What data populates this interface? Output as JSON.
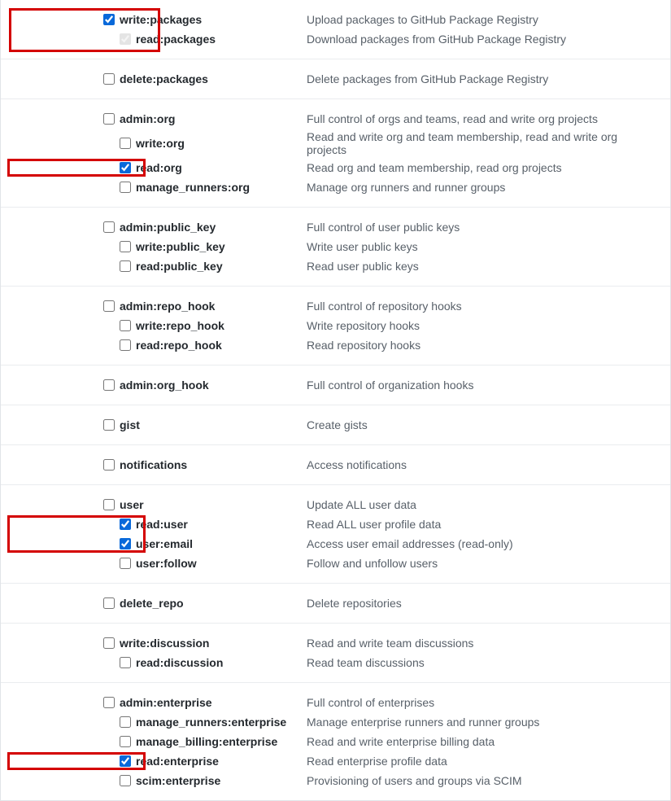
{
  "highlight_color": "#d40000",
  "sections": [
    {
      "highlight": true,
      "parent": {
        "label": "write:packages",
        "desc": "Upload packages to GitHub Package Registry",
        "checked": true,
        "disabled": false
      },
      "children": [
        {
          "label": "read:packages",
          "desc": "Download packages from GitHub Package Registry",
          "checked": true,
          "disabled": true
        }
      ]
    },
    {
      "parent": {
        "label": "delete:packages",
        "desc": "Delete packages from GitHub Package Registry",
        "checked": false
      },
      "children": []
    },
    {
      "parent": {
        "label": "admin:org",
        "desc": "Full control of orgs and teams, read and write org projects",
        "checked": false
      },
      "children": [
        {
          "label": "write:org",
          "desc": "Read and write org and team membership, read and write org projects",
          "checked": false
        },
        {
          "label": "read:org",
          "desc": "Read org and team membership, read org projects",
          "checked": true,
          "highlight": true
        },
        {
          "label": "manage_runners:org",
          "desc": "Manage org runners and runner groups",
          "checked": false
        }
      ]
    },
    {
      "parent": {
        "label": "admin:public_key",
        "desc": "Full control of user public keys",
        "checked": false
      },
      "children": [
        {
          "label": "write:public_key",
          "desc": "Write user public keys",
          "checked": false
        },
        {
          "label": "read:public_key",
          "desc": "Read user public keys",
          "checked": false
        }
      ]
    },
    {
      "parent": {
        "label": "admin:repo_hook",
        "desc": "Full control of repository hooks",
        "checked": false
      },
      "children": [
        {
          "label": "write:repo_hook",
          "desc": "Write repository hooks",
          "checked": false
        },
        {
          "label": "read:repo_hook",
          "desc": "Read repository hooks",
          "checked": false
        }
      ]
    },
    {
      "parent": {
        "label": "admin:org_hook",
        "desc": "Full control of organization hooks",
        "checked": false
      },
      "children": []
    },
    {
      "parent": {
        "label": "gist",
        "desc": "Create gists",
        "checked": false
      },
      "children": []
    },
    {
      "parent": {
        "label": "notifications",
        "desc": "Access notifications",
        "checked": false
      },
      "children": []
    },
    {
      "parent": {
        "label": "user",
        "desc": "Update ALL user data",
        "checked": false
      },
      "children": [
        {
          "label": "read:user",
          "desc": "Read ALL user profile data",
          "checked": true,
          "highlight_group": "user"
        },
        {
          "label": "user:email",
          "desc": "Access user email addresses (read-only)",
          "checked": true,
          "highlight_group": "user"
        },
        {
          "label": "user:follow",
          "desc": "Follow and unfollow users",
          "checked": false
        }
      ]
    },
    {
      "parent": {
        "label": "delete_repo",
        "desc": "Delete repositories",
        "checked": false
      },
      "children": []
    },
    {
      "parent": {
        "label": "write:discussion",
        "desc": "Read and write team discussions",
        "checked": false
      },
      "children": [
        {
          "label": "read:discussion",
          "desc": "Read team discussions",
          "checked": false
        }
      ]
    },
    {
      "parent": {
        "label": "admin:enterprise",
        "desc": "Full control of enterprises",
        "checked": false
      },
      "children": [
        {
          "label": "manage_runners:enterprise",
          "desc": "Manage enterprise runners and runner groups",
          "checked": false
        },
        {
          "label": "manage_billing:enterprise",
          "desc": "Read and write enterprise billing data",
          "checked": false
        },
        {
          "label": "read:enterprise",
          "desc": "Read enterprise profile data",
          "checked": true,
          "highlight": true
        },
        {
          "label": "scim:enterprise",
          "desc": "Provisioning of users and groups via SCIM",
          "checked": false
        }
      ]
    }
  ]
}
